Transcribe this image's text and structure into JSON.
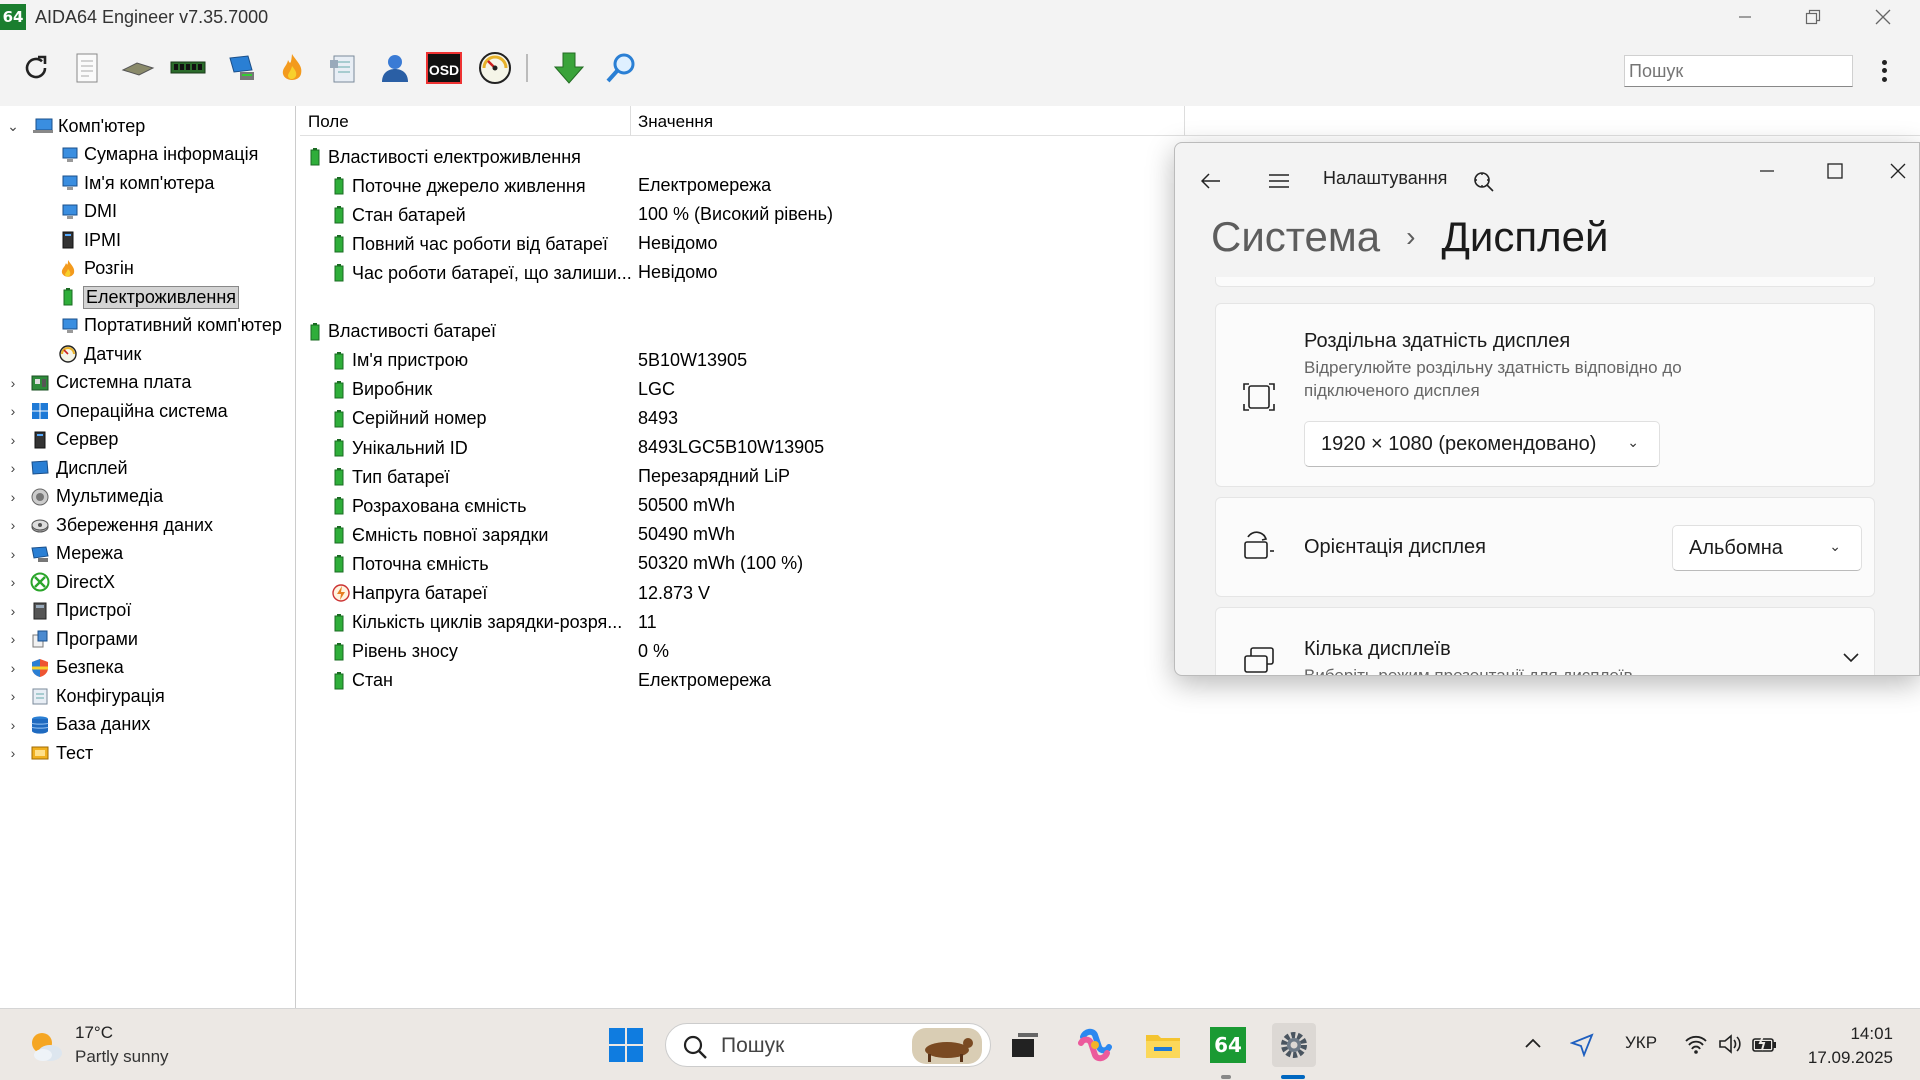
{
  "app": {
    "title": "AIDA64 Engineer v7.35.7000",
    "icon_text": "64",
    "search_placeholder": "Пошук"
  },
  "toolbar": {
    "buttons": [
      "refresh-icon",
      "report-icon",
      "motherboard-icon",
      "memory-icon",
      "network-icon",
      "stress-flame-icon",
      "benchmark-icon",
      "user-icon",
      "osd-icon",
      "sensor-gauge-icon",
      "download-icon",
      "search-tool-icon"
    ],
    "osd_label": "OSD"
  },
  "tree": {
    "root": "Комп'ютер",
    "children": [
      {
        "label": "Сумарна інформація",
        "icon": "monitor-icon"
      },
      {
        "label": "Ім'я комп'ютера",
        "icon": "monitor-icon"
      },
      {
        "label": "DMI",
        "icon": "monitor-icon"
      },
      {
        "label": "IPMI",
        "icon": "server-icon"
      },
      {
        "label": "Розгін",
        "icon": "flame-icon"
      },
      {
        "label": "Електроживлення",
        "icon": "battery-icon",
        "selected": true
      },
      {
        "label": "Портативний комп'ютер",
        "icon": "monitor-icon"
      },
      {
        "label": "Датчик",
        "icon": "gauge-icon"
      }
    ],
    "categories": [
      {
        "label": "Системна плата",
        "icon": "board-icon"
      },
      {
        "label": "Операційна система",
        "icon": "windows-icon"
      },
      {
        "label": "Сервер",
        "icon": "server-icon"
      },
      {
        "label": "Дисплей",
        "icon": "display-icon"
      },
      {
        "label": "Мультимедіа",
        "icon": "speaker-icon"
      },
      {
        "label": "Збереження даних",
        "icon": "disk-icon"
      },
      {
        "label": "Мережа",
        "icon": "network-icon"
      },
      {
        "label": "DirectX",
        "icon": "xbox-icon"
      },
      {
        "label": "Пристрої",
        "icon": "device-icon"
      },
      {
        "label": "Програми",
        "icon": "programs-icon"
      },
      {
        "label": "Безпека",
        "icon": "shield-icon"
      },
      {
        "label": "Конфігурація",
        "icon": "config-icon"
      },
      {
        "label": "База даних",
        "icon": "database-icon"
      },
      {
        "label": "Тест",
        "icon": "test-icon"
      }
    ]
  },
  "table": {
    "col_field": "Поле",
    "col_value": "Значення",
    "groups": [
      {
        "title": "Властивості електроживлення",
        "rows": [
          {
            "field": "Поточне джерело живлення",
            "value": "Електромережа"
          },
          {
            "field": "Стан батарей",
            "value": "100 % (Високий рівень)"
          },
          {
            "field": "Повний час роботи від батареї",
            "value": "Невідомо"
          },
          {
            "field": "Час роботи батареї, що залиши...",
            "value": "Невідомо"
          }
        ]
      },
      {
        "title": "Властивості батареї",
        "rows": [
          {
            "field": "Ім'я пристрою",
            "value": "5B10W13905"
          },
          {
            "field": "Виробник",
            "value": "LGC"
          },
          {
            "field": "Серійний номер",
            "value": "8493"
          },
          {
            "field": "Унікальний ID",
            "value": "8493LGC5B10W13905"
          },
          {
            "field": "Тип батареї",
            "value": "Перезарядний LiP"
          },
          {
            "field": "Розрахована ємність",
            "value": "50500 mWh"
          },
          {
            "field": "Ємність повної зарядки",
            "value": "50490 mWh"
          },
          {
            "field": "Поточна ємність",
            "value": "50320 mWh  (100 %)"
          },
          {
            "field": "Напруга батареї",
            "value": "12.873 V",
            "icon": "voltage-icon"
          },
          {
            "field": "Кількість циклів зарядки-розря...",
            "value": "11"
          },
          {
            "field": "Рівень зносу",
            "value": "0 %"
          },
          {
            "field": "Стан",
            "value": "Електромережа"
          }
        ]
      }
    ]
  },
  "settings": {
    "title": "Налаштування",
    "breadcrumb_parent": "Система",
    "breadcrumb_current": "Дисплей",
    "resolution": {
      "title": "Роздільна здатність дисплея",
      "subtitle_line1": "Відрегулюйте роздільну здатність відповідно до",
      "subtitle_line2": " підключеного дисплея",
      "value": "1920 × 1080 (рекомендовано)"
    },
    "orientation": {
      "title": "Орієнтація дисплея",
      "value": "Альбомна"
    },
    "multiple": {
      "title": "Кілька дисплеїв",
      "subtitle": "Виберіть режим презентації для дисплеїв"
    }
  },
  "taskbar": {
    "weather_temp": "17°C",
    "weather_desc": "Partly sunny",
    "search_text": "Пошук",
    "language": "УКР",
    "time": "14:01",
    "date": "17.09.2025",
    "aida_label": "64",
    "colors": {
      "accent": "#0067c0",
      "aida_green": "#1a9a33"
    }
  }
}
